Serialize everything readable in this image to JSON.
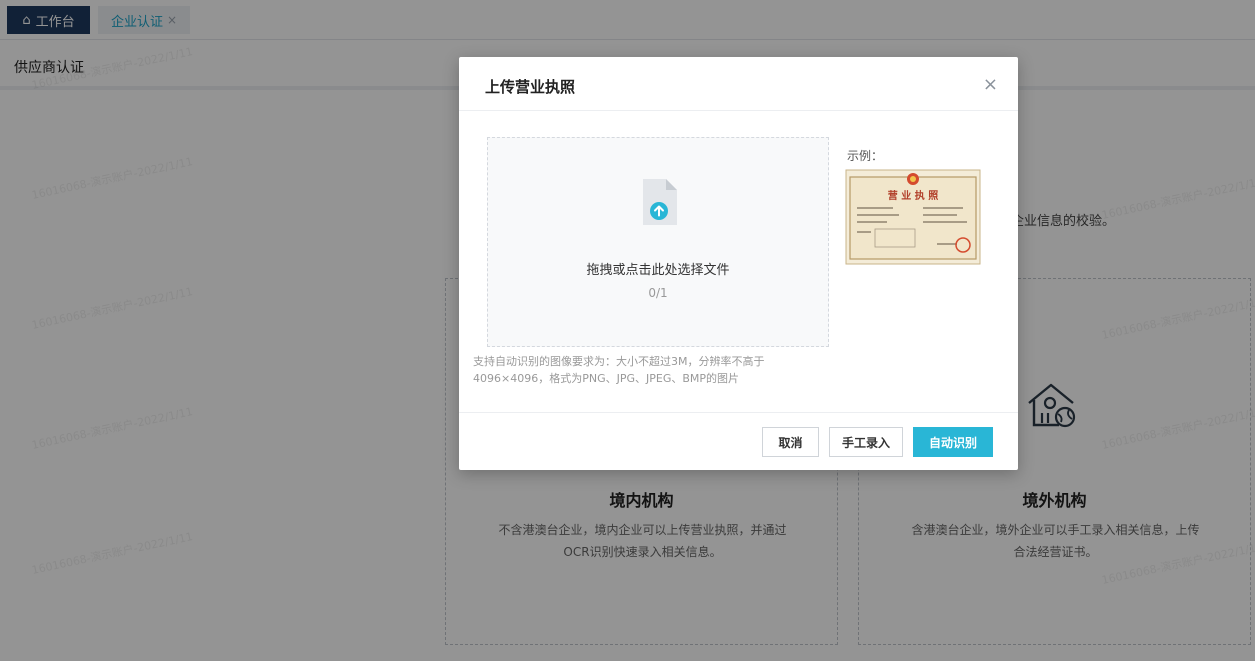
{
  "tabs": {
    "home_label": "工作台",
    "home_icon": "home-icon",
    "cert_label": "企业认证",
    "cert_close": "×"
  },
  "page": {
    "heading": "供应商认证",
    "hint_text": "企业信息的校验。"
  },
  "cards": {
    "domestic": {
      "title": "境内机构",
      "desc_line1": "不含港澳台企业，境内企业可以上传营业执照，并通过",
      "desc_line2": "OCR识别快速录入相关信息。"
    },
    "foreign": {
      "title": "境外机构",
      "desc_line1": "含港澳台企业，境外企业可以手工录入相关信息，上传",
      "desc_line2": "合法经营证书。",
      "icon": "house-globe-icon"
    }
  },
  "watermark": {
    "text": "16016068-演示账户-2022/1/11"
  },
  "modal": {
    "title": "上传营业执照",
    "close_label": "×",
    "upload": {
      "text": "拖拽或点击此处选择文件",
      "count": "0/1",
      "tip_line1": "支持自动识别的图像要求为：大小不超过3M，分辨率不高于",
      "tip_line2": "4096×4096，格式为PNG、JPG、JPEG、BMP的图片"
    },
    "example_label": "示例：",
    "sample_title": "营 业 执 照",
    "buttons": {
      "cancel": "取消",
      "manual": "手工录入",
      "auto": "自动识别"
    }
  },
  "colors": {
    "accent": "#29b6d6",
    "tab_dark": "#1e3a5f",
    "mask": "rgba(0,0,0,0.42)"
  }
}
